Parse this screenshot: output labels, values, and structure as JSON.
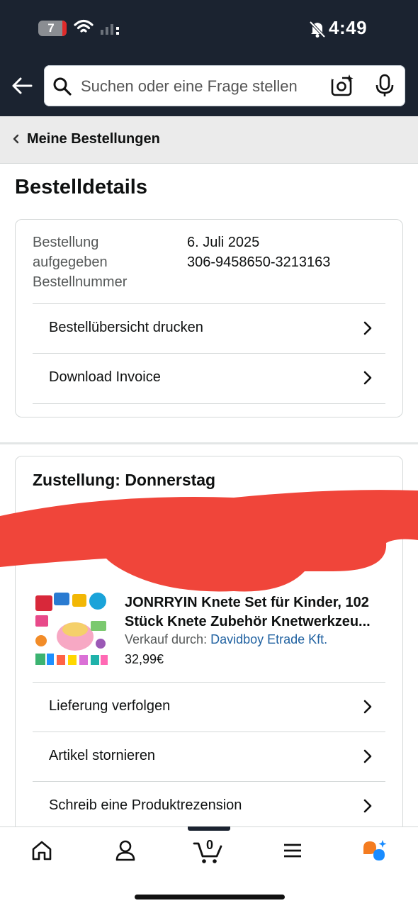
{
  "status_bar": {
    "battery": "7",
    "time": "4:49"
  },
  "search": {
    "placeholder": "Suchen oder eine Frage stellen"
  },
  "breadcrumb": {
    "label": "Meine Bestellungen"
  },
  "page": {
    "title": "Bestelldetails"
  },
  "order": {
    "date_label_1": "Bestellung",
    "date_label_2": "aufgegeben",
    "number_label": "Bestellnummer",
    "date_value": "6. Juli 2025",
    "number_value": "306-9458650-3213163",
    "actions": [
      {
        "label": "Bestellübersicht drucken"
      },
      {
        "label": "Download Invoice"
      }
    ]
  },
  "delivery": {
    "title": "Zustellung: Donnerstag",
    "product": {
      "title_line_1": "JONRRYIN Knete Set für Kinder, 102",
      "title_line_2": "Stück Knete Zubehör Knetwerkzeu...",
      "seller_prefix": "Verkauf durch: ",
      "seller_name": "Davidboy Etrade Kft.",
      "price": "32,99€"
    },
    "actions": [
      {
        "label": "Lieferung verfolgen"
      },
      {
        "label": "Artikel stornieren"
      },
      {
        "label": "Schreib eine Produktrezension"
      }
    ]
  },
  "bottom_nav": {
    "cart_count": "0",
    "items": [
      "home-icon",
      "account-icon",
      "cart-icon",
      "menu-icon",
      "rufus-icon"
    ]
  },
  "colors": {
    "header_bg": "#1b2330",
    "link": "#2162a1",
    "redaction": "#f0453a"
  }
}
